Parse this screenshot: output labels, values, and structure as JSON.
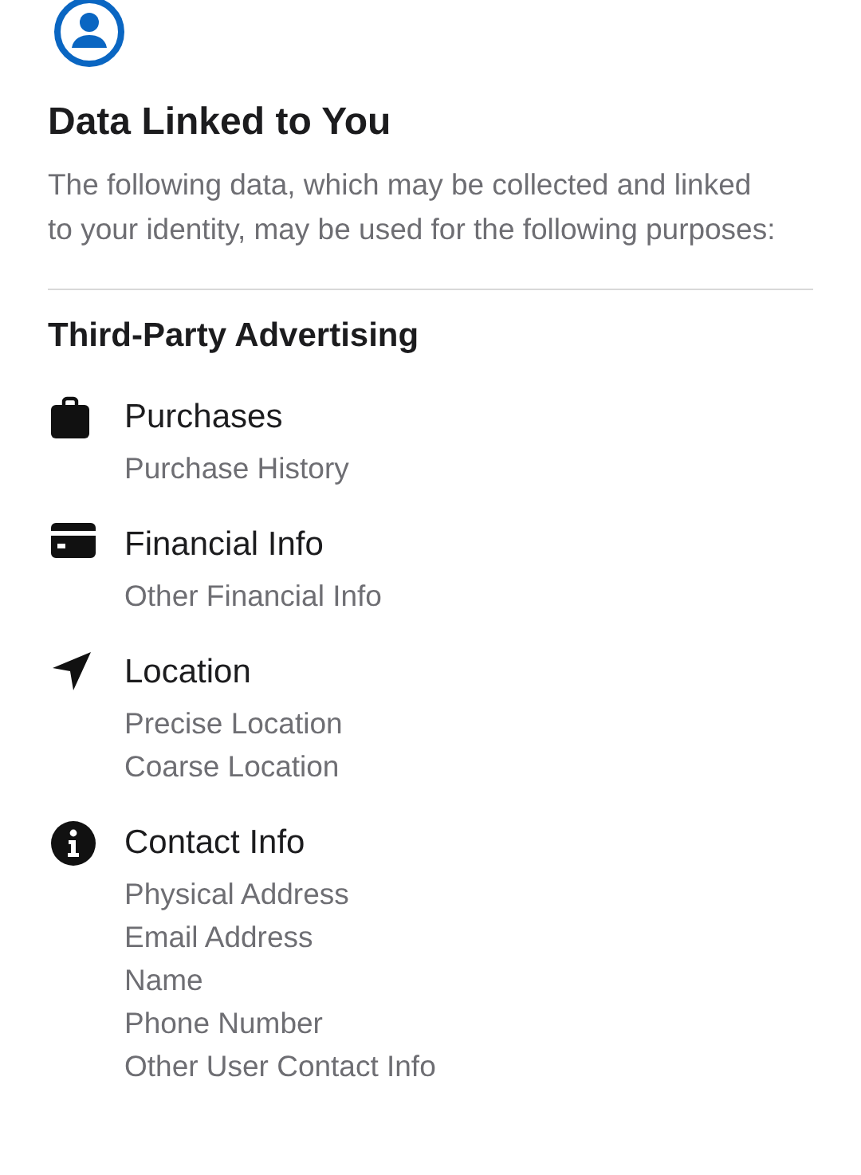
{
  "title": "Data Linked to You",
  "description": "The following data, which may be collected and linked to your identity, may be used for the following purposes:",
  "section": {
    "heading": "Third-Party Advertising",
    "items": [
      {
        "kind": "bag",
        "title": "Purchases",
        "details": [
          "Purchase History"
        ]
      },
      {
        "kind": "card",
        "title": "Financial Info",
        "details": [
          "Other Financial Info"
        ]
      },
      {
        "kind": "location",
        "title": "Location",
        "details": [
          "Precise Location",
          "Coarse Location"
        ]
      },
      {
        "kind": "info",
        "title": "Contact Info",
        "details": [
          "Physical Address",
          "Email Address",
          "Name",
          "Phone Number",
          "Other User Contact Info"
        ]
      }
    ]
  }
}
